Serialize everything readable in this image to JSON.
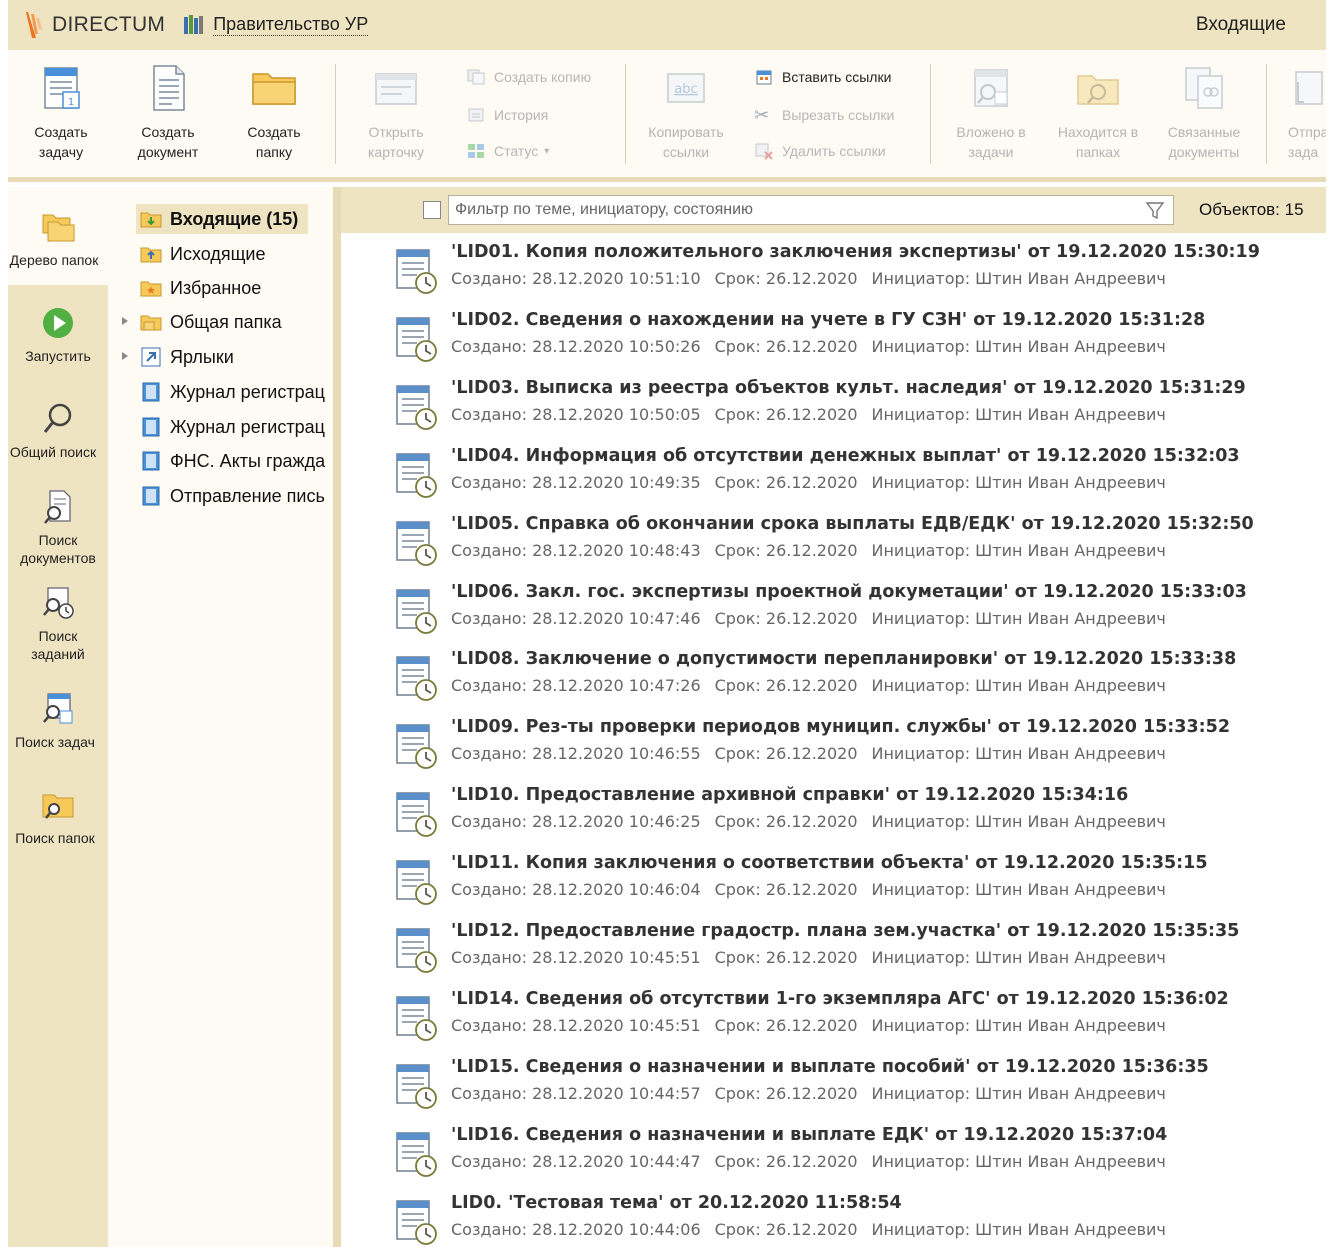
{
  "titlebar": {
    "logo_text": "DIRECTUM",
    "org": "Правительство УР",
    "window_title": "Входящие"
  },
  "ribbon": {
    "create_task": [
      "Создать",
      "задачу"
    ],
    "create_doc": [
      "Создать",
      "документ"
    ],
    "create_folder": [
      "Создать",
      "папку"
    ],
    "open_card": [
      "Открыть",
      "карточку"
    ],
    "create_copy": "Создать копию",
    "history": "История",
    "status": "Статус",
    "copy_links": [
      "Копировать",
      "ссылки"
    ],
    "paste_links": "Вставить ссылки",
    "cut_links": "Вырезать ссылки",
    "delete_links": "Удалить ссылки",
    "in_tasks": [
      "Вложено в",
      "задачи"
    ],
    "in_folders": [
      "Находится в",
      "папках"
    ],
    "related_docs": [
      "Связанные",
      "документы"
    ],
    "send_task": [
      "Отпра",
      "зада"
    ]
  },
  "leftnav": {
    "folder_tree": "Дерево папок",
    "run": "Запустить",
    "general_search": "Общий поиск",
    "doc_search": [
      "Поиск",
      "документов"
    ],
    "job_search": [
      "Поиск",
      "заданий"
    ],
    "task_search": "Поиск задач",
    "folder_search": "Поиск папок"
  },
  "tree": [
    {
      "label": "Входящие (15)"
    },
    {
      "label": "Исходящие"
    },
    {
      "label": "Избранное"
    },
    {
      "label": "Общая папка"
    },
    {
      "label": "Ярлыки"
    },
    {
      "label": "Журнал регистрац"
    },
    {
      "label": "Журнал регистрац"
    },
    {
      "label": "ФНС. Акты гражда"
    },
    {
      "label": "Отправление пись"
    }
  ],
  "filter": {
    "placeholder": "Фильтр по теме, инициатору, состоянию",
    "count": "Объектов: 15"
  },
  "rows": [
    {
      "title": "'LID01. Копия положительного заключения экспертизы' от 19.12.2020 15:30:19",
      "created": "Создано: 28.12.2020 10:51:10",
      "deadline": "Срок: 26.12.2020",
      "initiator": "Инициатор: Штин Иван Андреевич"
    },
    {
      "title": "'LID02. Сведения о нахождении на учете в ГУ СЗН' от 19.12.2020 15:31:28",
      "created": "Создано: 28.12.2020 10:50:26",
      "deadline": "Срок: 26.12.2020",
      "initiator": "Инициатор: Штин Иван Андреевич"
    },
    {
      "title": "'LID03. Выписка из реестра объектов культ. наследия' от 19.12.2020 15:31:29",
      "created": "Создано: 28.12.2020 10:50:05",
      "deadline": "Срок: 26.12.2020",
      "initiator": "Инициатор: Штин Иван Андреевич"
    },
    {
      "title": "'LID04. Информация об отсутствии денежных выплат' от 19.12.2020 15:32:03",
      "created": "Создано: 28.12.2020 10:49:35",
      "deadline": "Срок: 26.12.2020",
      "initiator": "Инициатор: Штин Иван Андреевич"
    },
    {
      "title": "'LID05. Справка об окончании срока выплаты ЕДВ/ЕДК' от 19.12.2020 15:32:50",
      "created": "Создано: 28.12.2020 10:48:43",
      "deadline": "Срок: 26.12.2020",
      "initiator": "Инициатор: Штин Иван Андреевич"
    },
    {
      "title": "'LID06. Закл. гос. экспертизы проектной докуметации' от 19.12.2020 15:33:03",
      "created": "Создано: 28.12.2020 10:47:46",
      "deadline": "Срок: 26.12.2020",
      "initiator": "Инициатор: Штин Иван Андреевич"
    },
    {
      "title": "'LID08. Заключение о допустимости перепланировки' от 19.12.2020 15:33:38",
      "created": "Создано: 28.12.2020 10:47:26",
      "deadline": "Срок: 26.12.2020",
      "initiator": "Инициатор: Штин Иван Андреевич"
    },
    {
      "title": "'LID09. Рез-ты проверки периодов муницип. службы' от 19.12.2020 15:33:52",
      "created": "Создано: 28.12.2020 10:46:55",
      "deadline": "Срок: 26.12.2020",
      "initiator": "Инициатор: Штин Иван Андреевич"
    },
    {
      "title": "'LID10. Предоставление архивной справки' от 19.12.2020 15:34:16",
      "created": "Создано: 28.12.2020 10:46:25",
      "deadline": "Срок: 26.12.2020",
      "initiator": "Инициатор: Штин Иван Андреевич"
    },
    {
      "title": "'LID11. Копия заключения о соответствии объекта' от 19.12.2020 15:35:15",
      "created": "Создано: 28.12.2020 10:46:04",
      "deadline": "Срок: 26.12.2020",
      "initiator": "Инициатор: Штин Иван Андреевич"
    },
    {
      "title": "'LID12. Предоставление градостр. плана зем.участка' от 19.12.2020 15:35:35",
      "created": "Создано: 28.12.2020 10:45:51",
      "deadline": "Срок: 26.12.2020",
      "initiator": "Инициатор: Штин Иван Андреевич"
    },
    {
      "title": "'LID14. Сведения об отсутствии 1-го экземпляра АГС' от 19.12.2020 15:36:02",
      "created": "Создано: 28.12.2020 10:45:51",
      "deadline": "Срок: 26.12.2020",
      "initiator": "Инициатор: Штин Иван Андреевич"
    },
    {
      "title": "'LID15. Сведения о назначении и выплате пособий' от 19.12.2020 15:36:35",
      "created": "Создано: 28.12.2020 10:44:57",
      "deadline": "Срок: 26.12.2020",
      "initiator": "Инициатор: Штин Иван Андреевич"
    },
    {
      "title": "'LID16. Сведения о назначении и выплате ЕДК' от 19.12.2020 15:37:04",
      "created": "Создано: 28.12.2020 10:44:47",
      "deadline": "Срок: 26.12.2020",
      "initiator": "Инициатор: Штин Иван Андреевич"
    },
    {
      "title": "LID0. 'Тестовая тема' от 20.12.2020 11:58:54",
      "created": "Создано: 28.12.2020 10:44:06",
      "deadline": "Срок: 26.12.2020",
      "initiator": "Инициатор: Штин Иван Андреевич"
    }
  ],
  "colors": {
    "panel": "#efe4c2",
    "ribbon_bg": "#fdfbf4",
    "accent_orange": "#e87722",
    "folder_yellow": "#f6c95a",
    "doc_blue": "#4a90d9"
  },
  "icons": {
    "logo": "directum-logo",
    "org": "books-icon",
    "create_task": "task-calendar-icon",
    "create_doc": "document-icon",
    "create_folder": "folder-icon",
    "row": "task-clock-icon"
  }
}
